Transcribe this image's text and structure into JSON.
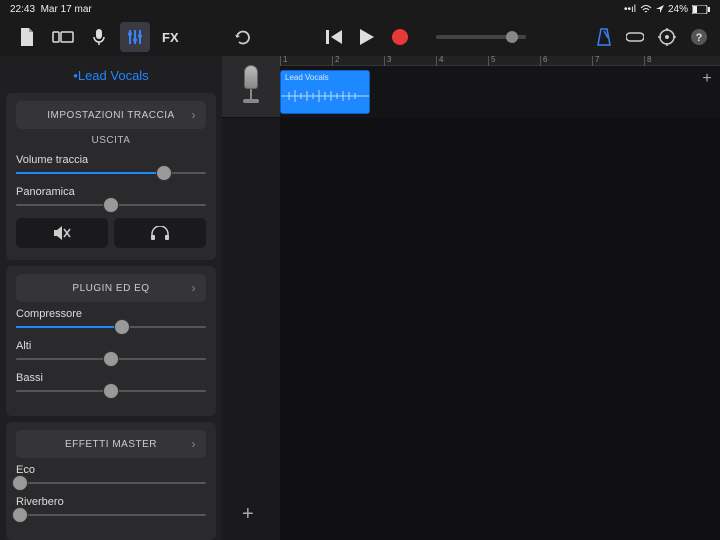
{
  "statusbar": {
    "time": "22:43",
    "date": "Mar 17 mar",
    "battery": "24%"
  },
  "toolbar": {
    "icons": {
      "document": "document-icon",
      "camera": "camera-icon",
      "mic": "mic-icon",
      "controls": "controls-icon",
      "fx": "FX",
      "undo": "undo-icon",
      "rewind": "rewind-icon",
      "play": "play-icon",
      "record": "record-icon",
      "metronome": "metronome-icon",
      "loop": "loop-icon",
      "settings": "settings-icon",
      "help": "help-icon"
    }
  },
  "sidebar": {
    "trackname": "•Lead Vocals",
    "trackSettings": {
      "header": "IMPOSTAZIONI TRACCIA",
      "output": "USCITA"
    },
    "volume": {
      "label": "Volume traccia",
      "value": 0.78
    },
    "pan": {
      "label": "Panoramica",
      "value": 0.5
    },
    "pluginEq": {
      "header": "PLUGIN ED EQ"
    },
    "compressor": {
      "label": "Compressore",
      "value": 0.56
    },
    "highs": {
      "label": "Alti",
      "value": 0.5
    },
    "lows": {
      "label": "Bassi",
      "value": 0.5
    },
    "masterFx": {
      "header": "EFFETTI MASTER"
    },
    "echo": {
      "label": "Eco",
      "value": 0.02
    },
    "reverb": {
      "label": "Riverbero",
      "value": 0.02
    }
  },
  "timeline": {
    "ticks": [
      1,
      2,
      3,
      4,
      5,
      6,
      7,
      8
    ],
    "clip": {
      "label": "Lead Vocals",
      "start": 0,
      "width": 90
    }
  }
}
